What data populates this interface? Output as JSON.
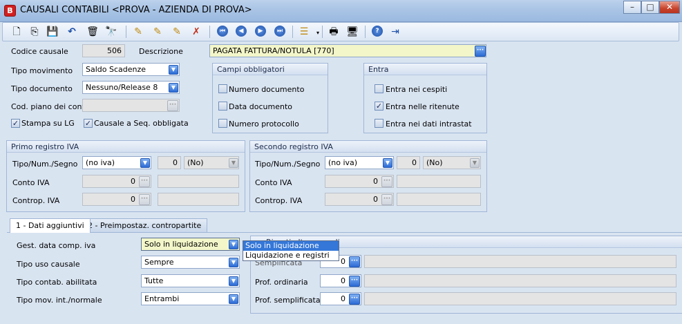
{
  "window": {
    "title": "CAUSALI CONTABILI <PROVA - AZIENDA DI PROVA>",
    "app_icon_letter": "B",
    "controls": {
      "minimize": "–",
      "maximize": "□",
      "close": "✕"
    }
  },
  "toolbar": {
    "icons": [
      "new-document-icon",
      "copy-document-icon",
      "save-icon",
      "undo-icon",
      "delete-icon",
      "find-icon",
      "edit1-icon",
      "edit2-icon",
      "edit3-icon",
      "edit-cancel-icon",
      "first-icon",
      "prev-icon",
      "next-icon",
      "last-icon",
      "list-icon",
      "print-icon",
      "preview-icon",
      "help-icon",
      "exit-icon"
    ]
  },
  "header": {
    "codice_label": "Codice causale",
    "codice_value": "506",
    "descrizione_label": "Descrizione",
    "descrizione_value": "PAGATA FATTURA/NOTULA    [770]",
    "tipo_movimento_label": "Tipo movimento",
    "tipo_movimento_value": "Saldo Scadenze",
    "tipo_documento_label": "Tipo documento",
    "tipo_documento_value": "Nessuno/Release 8",
    "piano_conti_label": "Cod. piano dei conti",
    "piano_conti_value": "",
    "stampa_label": "Stampa  su LG",
    "stampa_checked": true,
    "causale_seq_label": "Causale a Seq. obbligata",
    "causale_seq_checked": true
  },
  "campi_obbligatori": {
    "title": "Campi obbligatori",
    "items": [
      {
        "label": "Numero documento",
        "checked": false
      },
      {
        "label": "Data documento",
        "checked": false
      },
      {
        "label": "Numero protocollo",
        "checked": false
      }
    ]
  },
  "entra": {
    "title": "Entra",
    "items": [
      {
        "label": "Entra nei cespiti",
        "checked": false
      },
      {
        "label": "Entra nelle ritenute",
        "checked": true
      },
      {
        "label": "Entra nei dati intrastat",
        "checked": false
      }
    ]
  },
  "primo_iva": {
    "title": "Primo registro IVA",
    "tipo_label": "Tipo/Num./Segno",
    "tipo_value": "(no iva)",
    "num_value": "0",
    "segno_value": "(No)",
    "conto_label": "Conto IVA",
    "conto_value": "0",
    "controp_label": "Controp. IVA",
    "controp_value": "0"
  },
  "secondo_iva": {
    "title": "Secondo registro IVA",
    "tipo_label": "Tipo/Num./Segno",
    "tipo_value": "(no iva)",
    "num_value": "0",
    "segno_value": "(No)",
    "conto_label": "Conto IVA",
    "conto_value": "0",
    "controp_label": "Controp. IVA",
    "controp_value": "0"
  },
  "tabs": [
    {
      "label": "1 - Dati aggiuntivi",
      "active": true
    },
    {
      "label": "2 - Preimpostaz. contropartite",
      "active": false
    }
  ],
  "tab1": {
    "gest_label": "Gest. data comp. iva",
    "gest_value": "Solo in liquidazione",
    "uso_label": "Tipo uso causale",
    "uso_value": "Sempre",
    "contab_label": "Tipo contab. abilitata",
    "contab_value": "Tutte",
    "mov_label": "Tipo mov. int./normale",
    "mov_value": "Entrambi",
    "group_title": "Riporti altre causali",
    "semplificata_label": "Semplificata",
    "semplificata_value": "0",
    "prof_ord_label": "Prof. ordinaria",
    "prof_ord_value": "0",
    "prof_sem_label": "Prof. semplificata",
    "prof_sem_value": "0"
  },
  "dropdown_open": {
    "options": [
      "Solo in liquidazione",
      "Liquidazione e registri"
    ],
    "selected_index": 0
  }
}
